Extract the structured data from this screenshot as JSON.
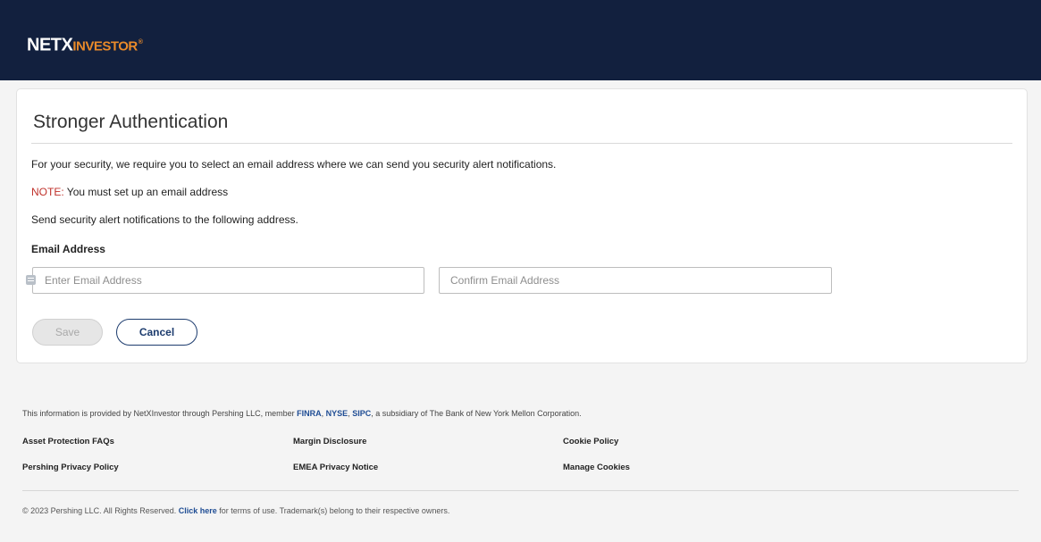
{
  "header": {
    "logo_part1": "NETX",
    "logo_part2": "INVESTOR",
    "logo_tm": "®",
    "bg_color": "#12203e",
    "accent_color": "#e98a2a"
  },
  "auth": {
    "title": "Stronger Authentication",
    "intro": "For your security, we require you to select an email address where we can send you security alert notifications.",
    "note_label": "NOTE:",
    "note_text": " You must set up an email address",
    "send_text": "Send security alert notifications to the following address.",
    "email_label": "Email Address",
    "email_placeholder": "Enter Email Address",
    "email_value": "",
    "confirm_placeholder": "Confirm Email Address",
    "confirm_value": "",
    "field_icon": "autofill-card-icon",
    "save_label": "Save",
    "cancel_label": "Cancel"
  },
  "footer": {
    "info_prefix": "This information is provided by NetXInvestor through Pershing LLC, member ",
    "finra": "FINRA",
    "sep1": ", ",
    "nyse": "NYSE",
    "sep2": ", ",
    "sipc": "SIPC",
    "info_suffix": ", a subsidiary of The Bank of New York Mellon Corporation.",
    "links": [
      "Asset Protection FAQs",
      "Margin Disclosure",
      "Cookie Policy",
      "Pershing Privacy Policy",
      "EMEA Privacy Notice",
      "Manage Cookies"
    ],
    "copyright_prefix": "© 2023 Pershing LLC. All Rights Reserved. ",
    "click_here": "Click here",
    "copyright_suffix": " for terms of use. Trademark(s) belong to their respective owners.",
    "link_color": "#1f4d94"
  }
}
